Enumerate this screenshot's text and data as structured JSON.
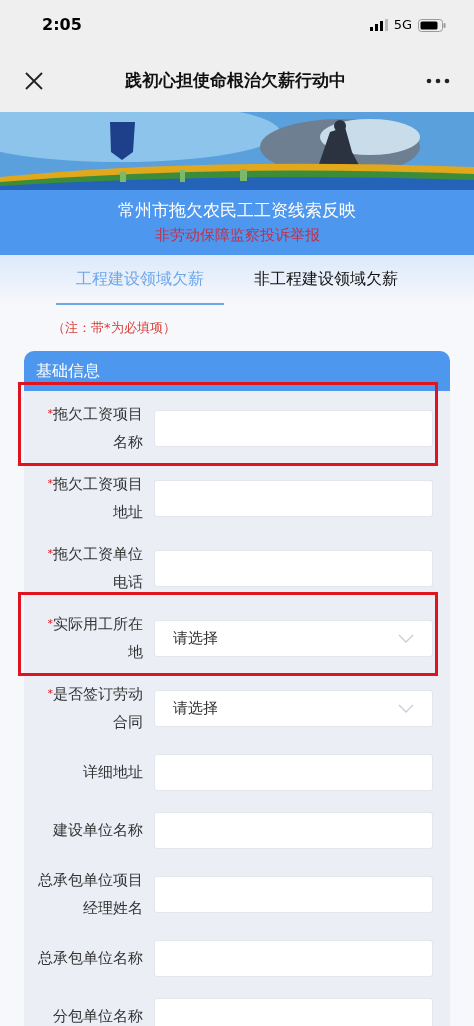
{
  "status_bar": {
    "time": "2:05",
    "network": "5G"
  },
  "nav": {
    "title": "践初心担使命根治欠薪行动中"
  },
  "header": {
    "title": "常州市拖欠农民工工资线索反映",
    "subtitle": "非劳动保障监察投诉举报"
  },
  "tabs": [
    {
      "label": "工程建设领域欠薪",
      "selected": true
    },
    {
      "label": "非工程建设领域欠薪",
      "selected": false
    }
  ],
  "note": "（注：带*为必填项）",
  "section": {
    "title": "基础信息",
    "required_mark": "*",
    "fields": [
      {
        "label": "拖欠工资项目名称",
        "required": true,
        "kind": "text",
        "highlighted": true
      },
      {
        "label": "拖欠工资项目地址",
        "required": true,
        "kind": "text",
        "highlighted": false
      },
      {
        "label": "拖欠工资单位电话",
        "required": true,
        "kind": "text",
        "highlighted": false
      },
      {
        "label": "实际用工所在地",
        "required": true,
        "kind": "select",
        "value": "请选择",
        "highlighted": true
      },
      {
        "label": "是否签订劳动合同",
        "required": true,
        "kind": "select",
        "value": "请选择",
        "highlighted": false
      },
      {
        "label": "详细地址",
        "required": false,
        "kind": "text",
        "highlighted": false
      },
      {
        "label": "建设单位名称",
        "required": false,
        "kind": "text",
        "highlighted": false
      },
      {
        "label": "总承包单位项目经理姓名",
        "required": false,
        "kind": "text",
        "highlighted": false
      },
      {
        "label": "总承包单位名称",
        "required": false,
        "kind": "text",
        "highlighted": false
      },
      {
        "label": "分包单位名称",
        "required": false,
        "kind": "text",
        "highlighted": false
      }
    ]
  }
}
